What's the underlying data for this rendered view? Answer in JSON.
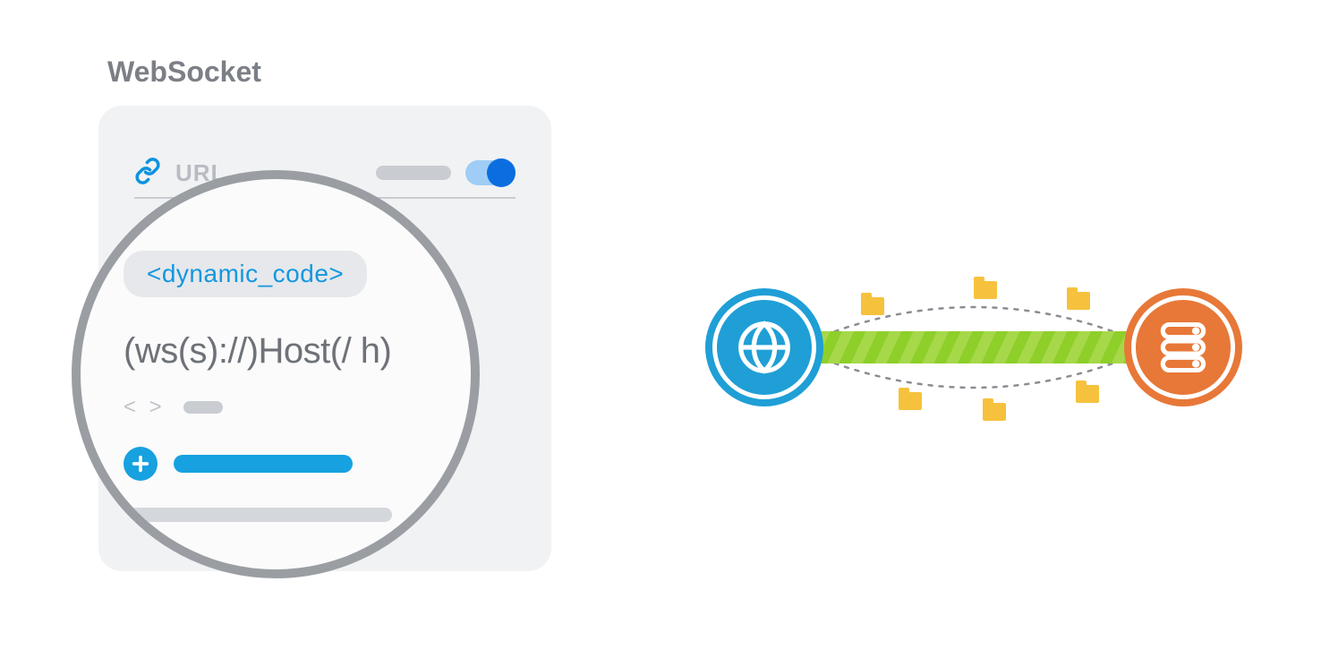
{
  "title": "WebSocket",
  "panel": {
    "url_label": "URL",
    "toggle_on": true
  },
  "magnifier": {
    "chip_text": "<dynamic_code>",
    "pattern_text": "(ws(s)://)Host(/ h)",
    "angles_text": "< >"
  },
  "diagram": {
    "left_node": "globe",
    "right_node": "server",
    "connection": "bidirectional-websocket",
    "packets": 6
  },
  "colors": {
    "accent_blue": "#17a1e0",
    "node_blue": "#1f9fd6",
    "node_orange": "#e77838",
    "bar_green": "#a6d84a",
    "folder_yellow": "#f6c23d"
  }
}
